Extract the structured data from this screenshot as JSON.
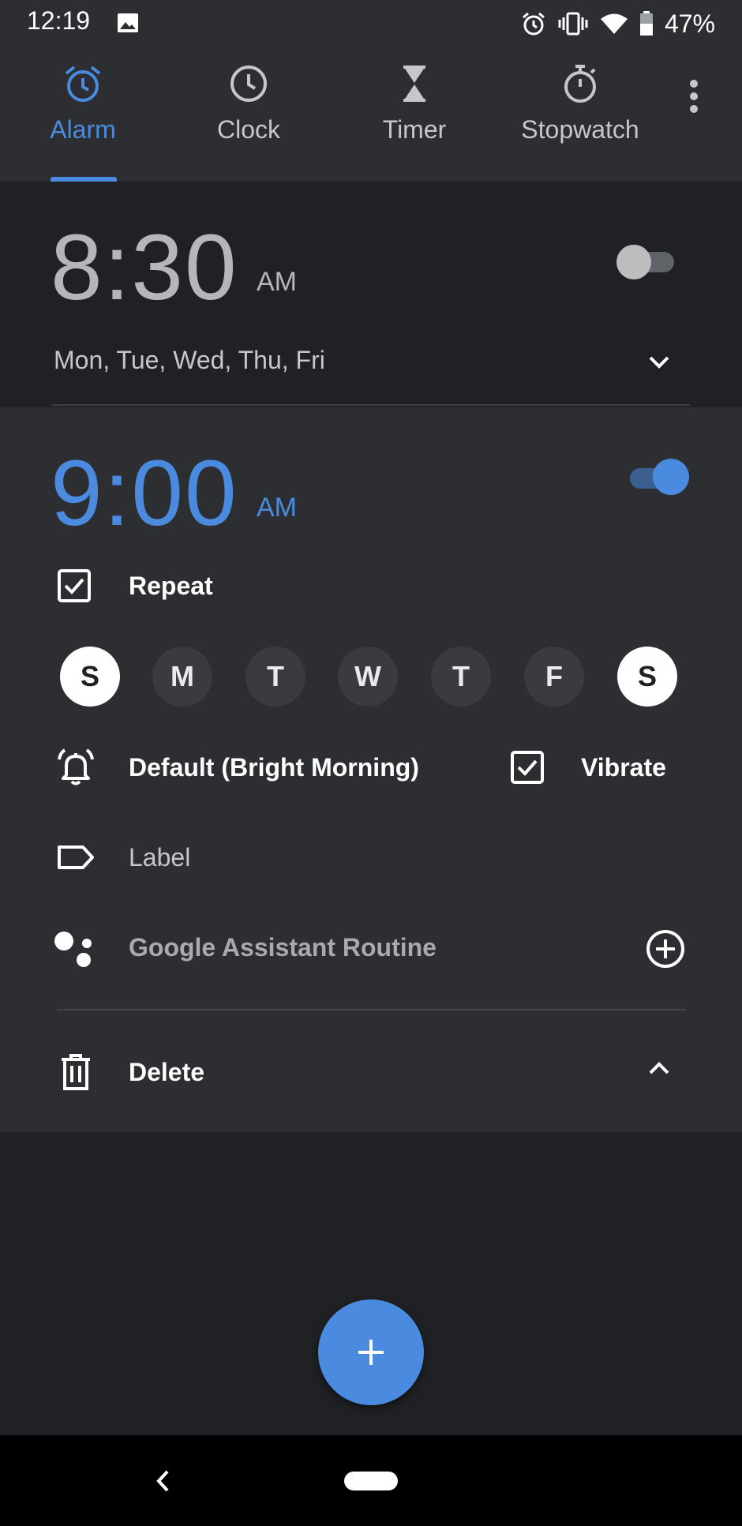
{
  "status_bar": {
    "time": "12:19",
    "battery": "47%"
  },
  "tabs": [
    {
      "label": "Alarm",
      "icon": "alarm-clock-icon",
      "active": true
    },
    {
      "label": "Clock",
      "icon": "clock-icon",
      "active": false
    },
    {
      "label": "Timer",
      "icon": "hourglass-icon",
      "active": false
    },
    {
      "label": "Stopwatch",
      "icon": "stopwatch-icon",
      "active": false
    }
  ],
  "alarm1": {
    "time": "8:30",
    "ampm": "AM",
    "enabled": false,
    "days_summary": "Mon, Tue, Wed, Thu, Fri"
  },
  "alarm2": {
    "time": "9:00",
    "ampm": "AM",
    "enabled": true,
    "repeat_label": "Repeat",
    "repeat_checked": true,
    "days": [
      {
        "letter": "S",
        "selected": true
      },
      {
        "letter": "M",
        "selected": false
      },
      {
        "letter": "T",
        "selected": false
      },
      {
        "letter": "W",
        "selected": false
      },
      {
        "letter": "T",
        "selected": false
      },
      {
        "letter": "F",
        "selected": false
      },
      {
        "letter": "S",
        "selected": true
      }
    ],
    "ringtone": "Default (Bright Morning)",
    "vibrate_label": "Vibrate",
    "vibrate_checked": true,
    "label_text": "Label",
    "assistant_text": "Google Assistant Routine",
    "delete_label": "Delete"
  },
  "colors": {
    "accent": "#4a8be0",
    "background": "#202124",
    "surface": "#2d2e32",
    "muted_text": "#a8aaae"
  }
}
